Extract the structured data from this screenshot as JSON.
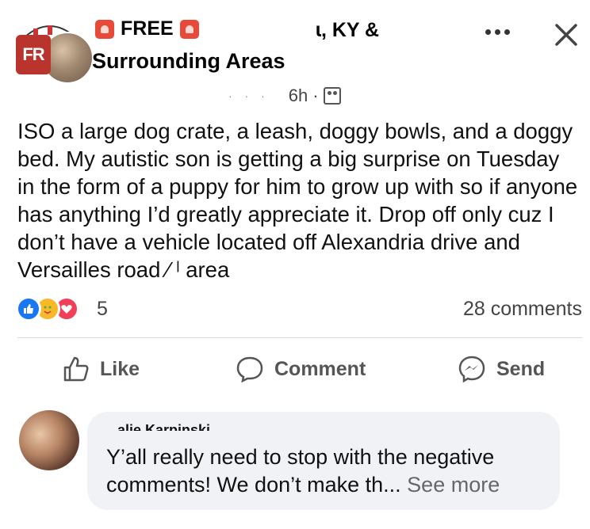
{
  "post": {
    "group_title_line1": "FREE",
    "group_title_line2": "Surrounding Areas",
    "location_partial": "ɩ, KY &",
    "time": "6h",
    "meta_separator": "·",
    "text": "ISO a large dog crate, a leash, doggy bowls, and a doggy bed. My autistic son is getting a big surprise on Tuesday in the form of a puppy for him to grow up with so if anyone has anything I’d greatly appreciate it. Drop off only cuz I don’t have a vehicle located off Alexandria drive and Versailles road ⁄        ˡ area",
    "group_logo_text": "FR"
  },
  "reactions": {
    "count": "5",
    "comments": "28 comments"
  },
  "actions": {
    "like": "Like",
    "comment": "Comment",
    "send": "Send"
  },
  "comment": {
    "author_partial": "alie Karpinski",
    "text": "Y’all really need to stop with the negative comments! We don’t make th...",
    "see_more": "See more"
  },
  "colors": {
    "like_blue": "#1877f2",
    "love_red": "#f33e58",
    "care_yellow": "#f7b928",
    "bubble_bg": "#f0f2f5"
  }
}
